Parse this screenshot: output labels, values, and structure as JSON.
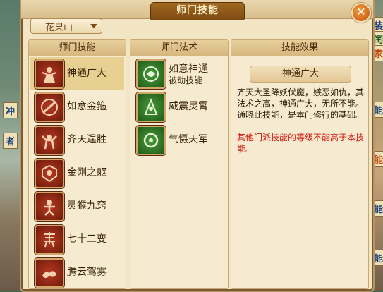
{
  "window": {
    "title": "师门技能",
    "close_label": "✕"
  },
  "dropdown": {
    "selected": "花果山"
  },
  "panels": {
    "school_skills": {
      "header": "师门技能",
      "items": [
        {
          "label": "神通广大",
          "icon": "skill-shentong-icon"
        },
        {
          "label": "如意金箍",
          "icon": "skill-jingu-icon"
        },
        {
          "label": "齐天逞胜",
          "icon": "skill-qitian-icon"
        },
        {
          "label": "金刚之躯",
          "icon": "skill-jingang-icon"
        },
        {
          "label": "灵猴九窍",
          "icon": "skill-linghou-icon"
        },
        {
          "label": "七十二变",
          "icon": "skill-72bian-icon"
        },
        {
          "label": "腾云驾雾",
          "icon": "skill-tengyun-icon"
        }
      ]
    },
    "school_spells": {
      "header": "师门法术",
      "items": [
        {
          "label": "如意神通",
          "sub": "被动技能",
          "icon": "spell-ruyi-icon"
        },
        {
          "label": "威震灵霄",
          "icon": "spell-weizhen-icon"
        },
        {
          "label": "气慑天军",
          "icon": "spell-qishe-icon"
        }
      ]
    },
    "skill_effect": {
      "header": "技能效果",
      "skill_name": "神通广大",
      "description": "齐天大圣降妖伏魔，嫉恶如仇，其法术之高，神通广大，无所不能。通晓此技能，是本门修行的基础。",
      "note": "其他门派技能的等级不能高于本技能。"
    }
  },
  "background": {
    "left_tags": [
      "冲",
      "者"
    ],
    "right_tags": [
      "装",
      "闰",
      "家",
      "能",
      "能",
      "能",
      "能"
    ]
  },
  "colors": {
    "accent": "#a0691f",
    "note_red": "#d0180e",
    "selected_row": "#e8d092"
  }
}
